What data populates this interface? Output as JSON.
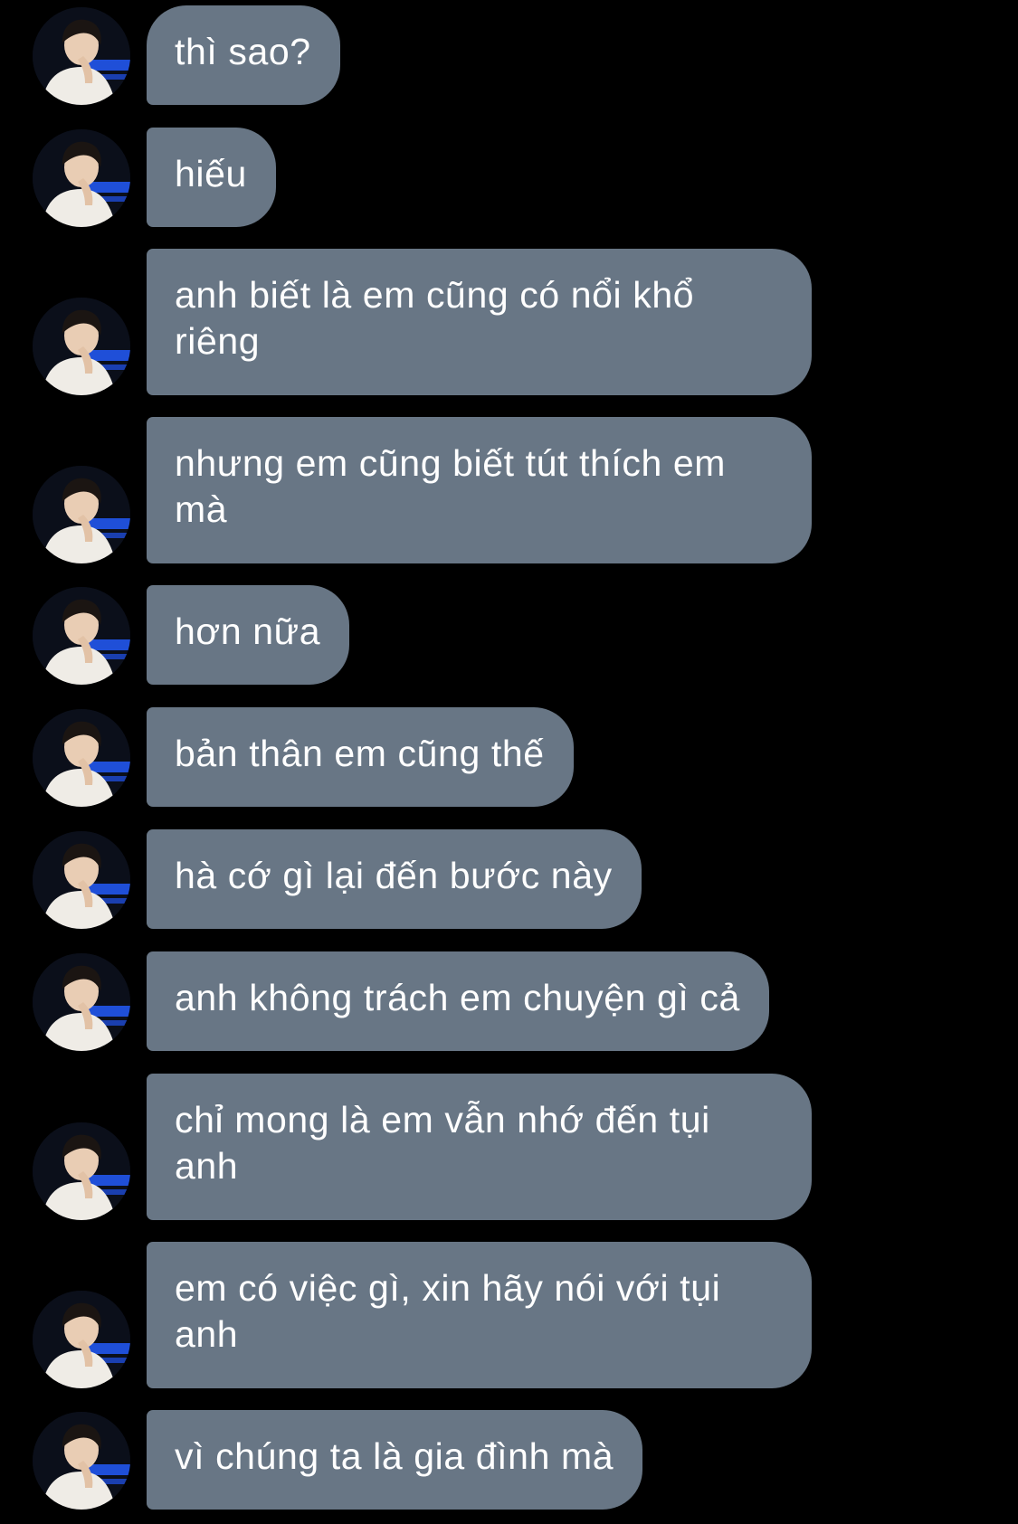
{
  "colors": {
    "background": "#000000",
    "bubble": "#687685",
    "bubble_text": "#ffffff"
  },
  "avatar": {
    "icon": "profile-photo-avatar"
  },
  "messages": [
    {
      "text": "thì sao?"
    },
    {
      "text": "hiếu"
    },
    {
      "text": "anh biết là em cũng có nổi khổ\nriêng"
    },
    {
      "text": "nhưng em cũng biết tút thích em\nmà"
    },
    {
      "text": "hơn nữa"
    },
    {
      "text": "bản thân em cũng thế"
    },
    {
      "text": "hà cớ gì lại đến bước này"
    },
    {
      "text": "anh không trách em chuyện gì cả"
    },
    {
      "text": "chỉ mong là em vẫn nhớ đến tụi\nanh"
    },
    {
      "text": "em có việc gì, xin hãy nói với tụi\nanh"
    },
    {
      "text": "vì chúng ta là gia đình mà"
    }
  ]
}
